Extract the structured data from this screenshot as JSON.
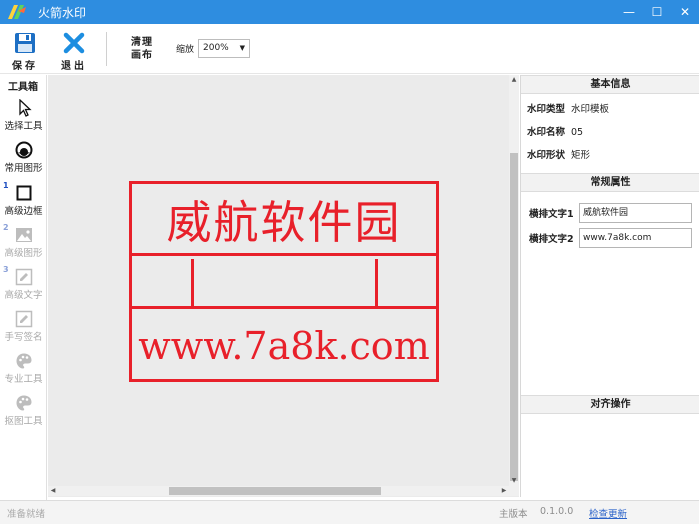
{
  "window": {
    "title": "火箭水印",
    "minimize_glyph": "—",
    "maximize_glyph": "☐",
    "close_glyph": "✕"
  },
  "toolbar": {
    "save_label": "保存",
    "exit_label": "退出",
    "clear_line1": "清理",
    "clear_line2": "画布",
    "zoom_label": "缩放",
    "zoom_value": "200%",
    "zoom_caret": "▼"
  },
  "toolbox": {
    "title": "工具箱",
    "items": [
      {
        "label": "选择工具",
        "icon": "cursor-icon",
        "enabled": true
      },
      {
        "label": "常用图形",
        "icon": "circle-shape-icon",
        "enabled": true
      },
      {
        "label": "高级边框",
        "icon": "square-border-icon",
        "enabled": true,
        "num": "1"
      },
      {
        "label": "高级图形",
        "icon": "image-icon",
        "enabled": false,
        "num": "2"
      },
      {
        "label": "高级文字",
        "icon": "edit-text-icon",
        "enabled": false,
        "num": "3"
      },
      {
        "label": "手写签名",
        "icon": "signature-icon",
        "enabled": false
      },
      {
        "label": "专业工具",
        "icon": "palette-icon",
        "enabled": false
      },
      {
        "label": "抠图工具",
        "icon": "palette-icon",
        "enabled": false
      }
    ]
  },
  "canvas": {
    "stamp_top_text": "威航软件园",
    "stamp_bottom_text": "www.7a8k.com",
    "stamp_color": "#e8202a",
    "scroll_up": "▲",
    "scroll_down": "▼",
    "scroll_left": "◀",
    "scroll_right": "▶"
  },
  "properties": {
    "basic_header": "基本信息",
    "type_label": "水印类型",
    "type_value": "水印模板",
    "name_label": "水印名称",
    "name_value": "05",
    "shape_label": "水印形状",
    "shape_value": "矩形",
    "general_header": "常规属性",
    "text1_label": "横排文字1",
    "text1_value": "威航软件园",
    "text2_label": "横排文字2",
    "text2_value": "www.7a8k.com",
    "align_header": "对齐操作"
  },
  "status": {
    "left_text": "准备就绪",
    "version_label": "主版本",
    "version_value": "0.1.0.0",
    "update_link": "检查更新"
  },
  "colors": {
    "titlebar": "#2e8de0",
    "accent_blue": "#2a62c9",
    "stamp_red": "#e8202a"
  }
}
